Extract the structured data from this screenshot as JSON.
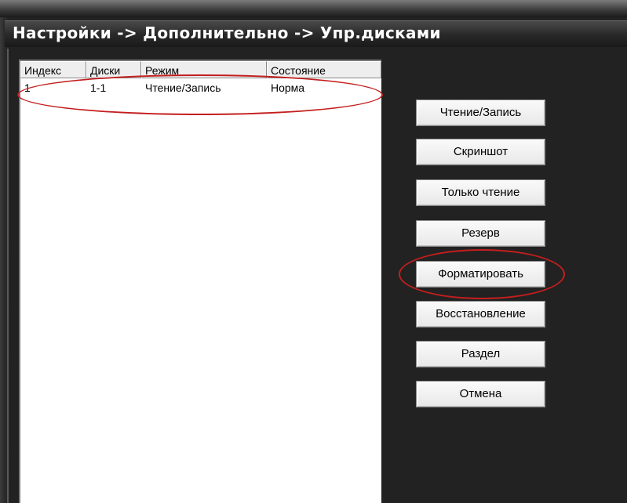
{
  "window": {
    "title": "Настройки -> Дополнительно -> Упр.дисками"
  },
  "table": {
    "columns": [
      "Индекс",
      "Диски",
      "Режим",
      "Состояние"
    ],
    "rows": [
      {
        "index": "1",
        "disk": "1-1",
        "mode": "Чтение/Запись",
        "state": "Норма"
      }
    ]
  },
  "buttons": {
    "read_write": "Чтение/Запись",
    "snapshot": "Скриншот",
    "read_only": "Только чтение",
    "reserve": "Резерв",
    "format": "Форматировать",
    "recover": "Восстановление",
    "partition": "Раздел",
    "cancel": "Отмена"
  },
  "colors": {
    "highlight": "#c41e1e",
    "background": "#222222",
    "panel": "#ffffff"
  }
}
